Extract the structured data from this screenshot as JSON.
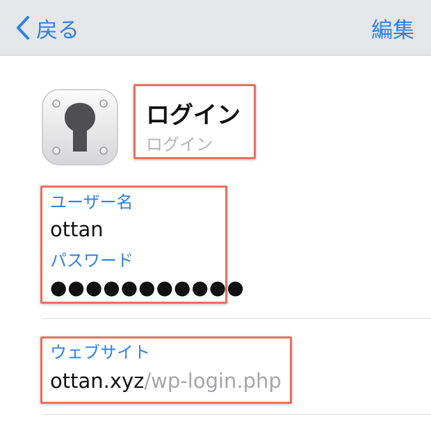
{
  "navbar": {
    "back_label": "戻る",
    "edit_label": "編集"
  },
  "header": {
    "icon": "keyhole-lock-icon",
    "title": "ログイン",
    "subtitle": "ログイン"
  },
  "credentials": {
    "username_label": "ユーザー名",
    "username_value": "ottan",
    "password_label": "パスワード",
    "password_value": "●●●●●●●●●●●"
  },
  "website": {
    "label": "ウェブサイト",
    "host": "ottan.xyz",
    "path": "/wp-login.php"
  },
  "colors": {
    "accent": "#2b82e5",
    "highlight_border": "#ea6f5f",
    "navbar_bg": "#e4e6ea"
  }
}
